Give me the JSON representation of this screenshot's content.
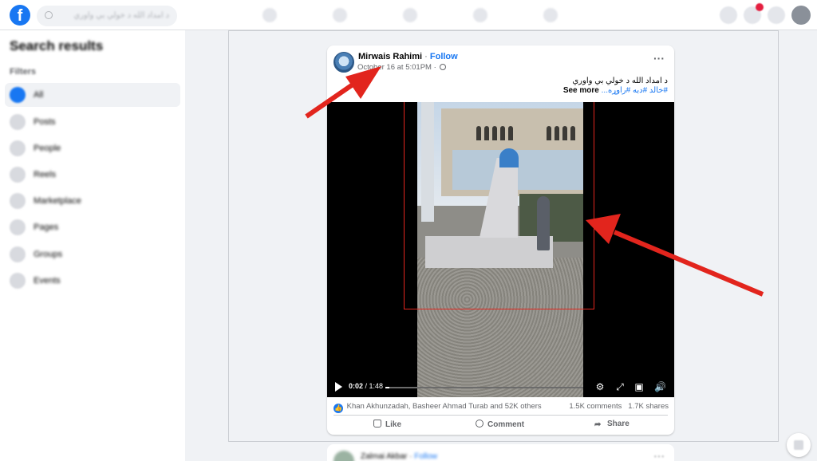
{
  "header": {
    "search_text": "د امداد الله د خولي بي واوري",
    "nav_icons": [
      "home-icon",
      "watch-icon",
      "marketplace-icon",
      "groups-icon",
      "gaming-icon"
    ],
    "right_icons": [
      "menu-icon",
      "messenger-icon",
      "notifications-icon"
    ]
  },
  "sidebar": {
    "title": "Search results",
    "filters_label": "Filters",
    "items": [
      {
        "label": "All",
        "icon": "all-icon"
      },
      {
        "label": "Posts",
        "icon": "posts-icon"
      },
      {
        "label": "People",
        "icon": "people-icon"
      },
      {
        "label": "Reels",
        "icon": "reels-icon"
      },
      {
        "label": "Marketplace",
        "icon": "marketplace-icon"
      },
      {
        "label": "Pages",
        "icon": "pages-icon"
      },
      {
        "label": "Groups",
        "icon": "groups-icon"
      },
      {
        "label": "Events",
        "icon": "events-icon"
      }
    ]
  },
  "post": {
    "author": "Mirwais Rahimi",
    "separator": "·",
    "follow_label": "Follow",
    "timestamp": "October 16 at 5:01PM",
    "separator2": "·",
    "text": "د امداد الله د خولي بي واوري",
    "see_more": "See more",
    "tags": "#خالد #دبه #راوړه...",
    "video": {
      "current_time": "0:02",
      "duration": "1:48",
      "progress": 0.02
    },
    "reactions": {
      "like_glyph": "👍",
      "names": "Khan Akhunzadah, Basheer Ahmad Turab and 52K others",
      "comments": "1.5K comments",
      "shares": "1.7K shares"
    },
    "actions": {
      "like": "Like",
      "comment": "Comment",
      "share": "Share"
    }
  },
  "next_post": {
    "author": "Zalmai Akbar",
    "follow_label": "Follow"
  },
  "colors": {
    "brand": "#1877f2",
    "annotation": "#e2251d"
  }
}
